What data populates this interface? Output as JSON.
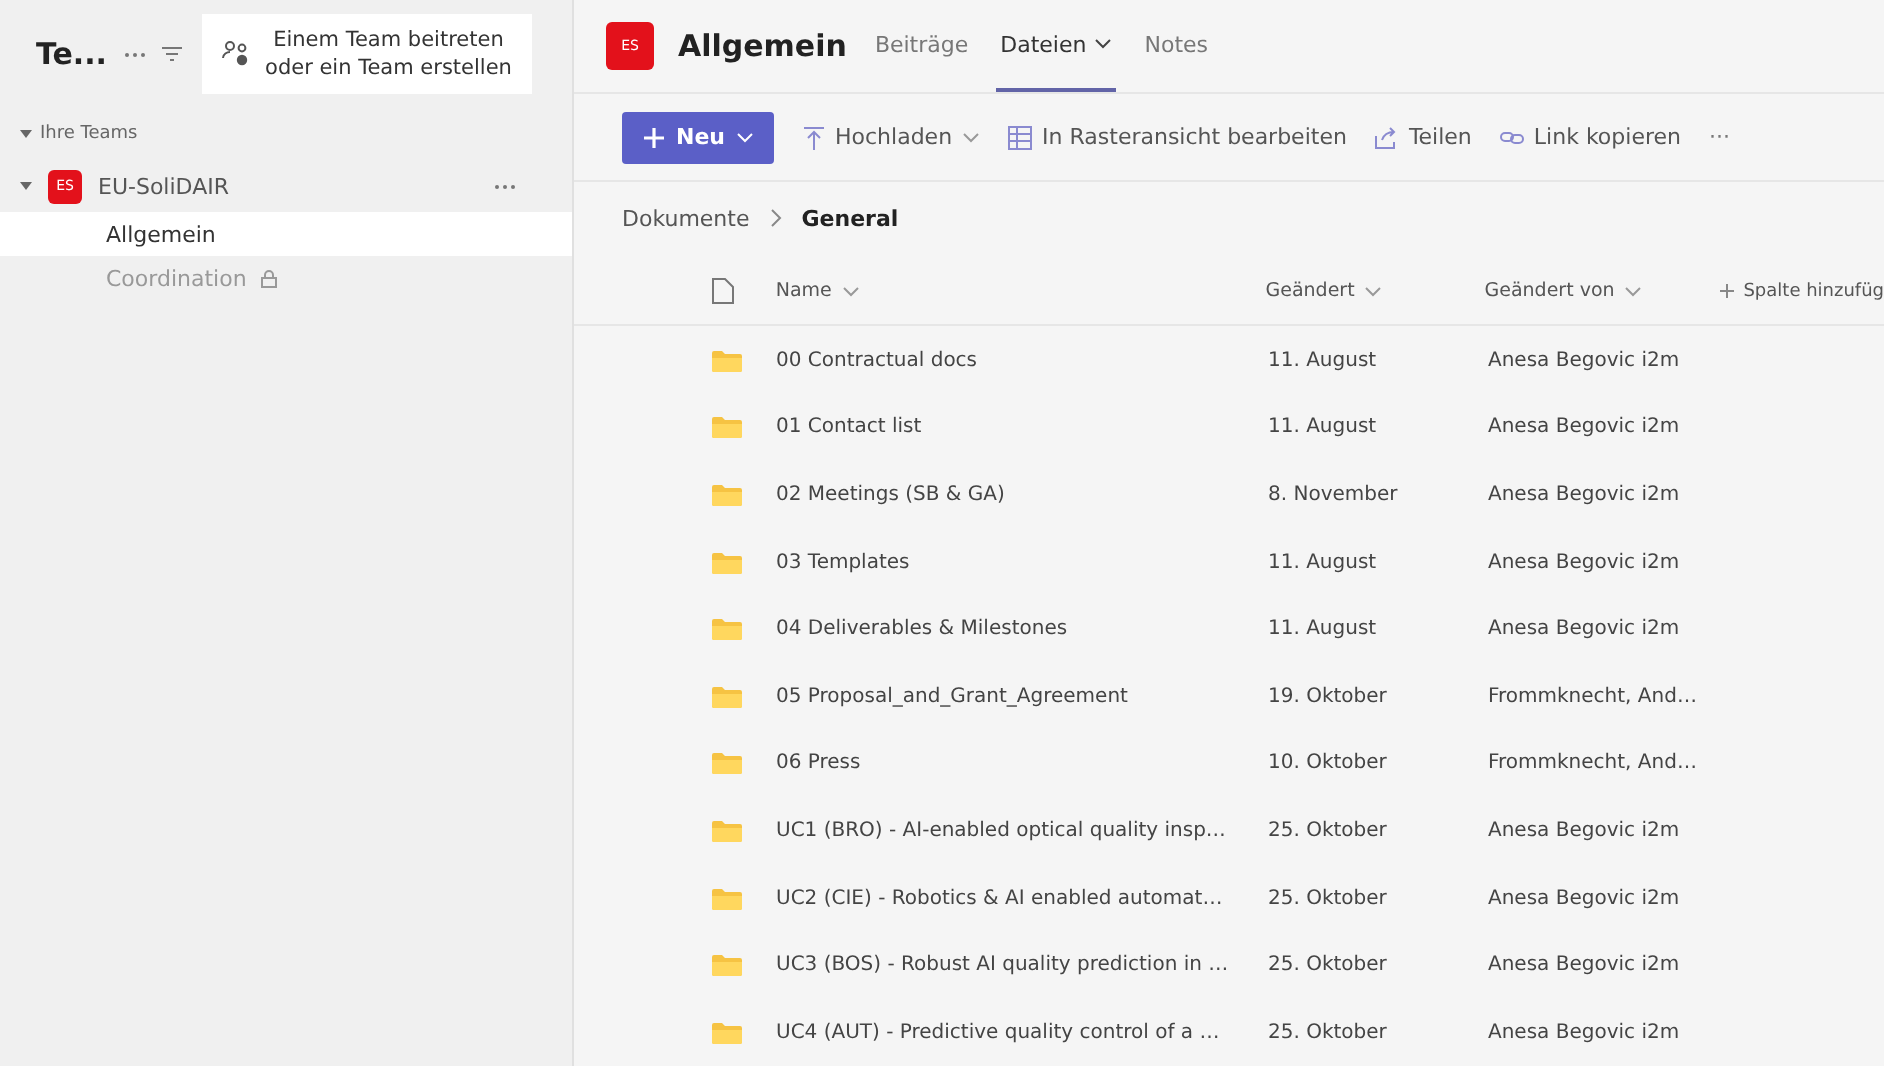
{
  "sidebar": {
    "title": "Te...",
    "join_button": {
      "line1": "Einem Team beitreten",
      "line2": "oder ein Team erstellen"
    },
    "section": {
      "label": "Ihre Teams",
      "expanded": true
    },
    "teams": [
      {
        "avatar": "ES",
        "name": "EU-SoliDAIR",
        "expanded": true,
        "channels": [
          {
            "name": "Allgemein",
            "selected": true,
            "locked": false
          },
          {
            "name": "Coordination",
            "selected": false,
            "locked": true
          }
        ]
      }
    ]
  },
  "header": {
    "avatar": "ES",
    "title": "Allgemein",
    "tabs": [
      {
        "label": "Beiträge",
        "selected": false,
        "dropdown": false
      },
      {
        "label": "Dateien",
        "selected": true,
        "dropdown": true
      },
      {
        "label": "Notes",
        "selected": false,
        "dropdown": false
      }
    ]
  },
  "toolbar": [
    {
      "kind": "primary",
      "label": "Neu"
    },
    {
      "kind": "action",
      "label": "Hochladen",
      "dropdown": true
    },
    {
      "kind": "action",
      "label": "In Rasteransicht bearbeiten",
      "dropdown": false
    },
    {
      "kind": "action",
      "label": "Teilen",
      "dropdown": false
    },
    {
      "kind": "action",
      "label": "Link kopieren",
      "dropdown": false
    },
    {
      "kind": "more",
      "label": "···"
    }
  ],
  "breadcrumb": [
    "Dokumente",
    "General"
  ],
  "table": {
    "columns": [
      "Name",
      "Geändert",
      "Geändert von"
    ],
    "add_column": "Spalte hinzufüg",
    "rows": [
      {
        "name": "00 Contractual docs",
        "modified": "11. August",
        "modified_by": "Anesa Begovic i2m"
      },
      {
        "name": "01 Contact list",
        "modified": "11. August",
        "modified_by": "Anesa Begovic i2m"
      },
      {
        "name": "02 Meetings (SB & GA)",
        "modified": "8. November",
        "modified_by": "Anesa Begovic i2m"
      },
      {
        "name": "03 Templates",
        "modified": "11. August",
        "modified_by": "Anesa Begovic i2m"
      },
      {
        "name": "04 Deliverables & Milestones",
        "modified": "11. August",
        "modified_by": "Anesa Begovic i2m"
      },
      {
        "name": "05 Proposal_and_Grant_Agreement",
        "modified": "19. Oktober",
        "modified_by": "Frommknecht, And…"
      },
      {
        "name": "06 Press",
        "modified": "10. Oktober",
        "modified_by": "Frommknecht, And…"
      },
      {
        "name": "UC1 (BRO) - AI-enabled optical quality insp…",
        "modified": "25. Oktober",
        "modified_by": "Anesa Begovic i2m"
      },
      {
        "name": "UC2 (CIE) - Robotics & AI enabled automat…",
        "modified": "25. Oktober",
        "modified_by": "Anesa Begovic i2m"
      },
      {
        "name": "UC3 (BOS) - Robust AI quality prediction in …",
        "modified": "25. Oktober",
        "modified_by": "Anesa Begovic i2m"
      },
      {
        "name": "UC4 (AUT) - Predictive quality control of a …",
        "modified": "25. Oktober",
        "modified_by": "Anesa Begovic i2m"
      }
    ]
  }
}
